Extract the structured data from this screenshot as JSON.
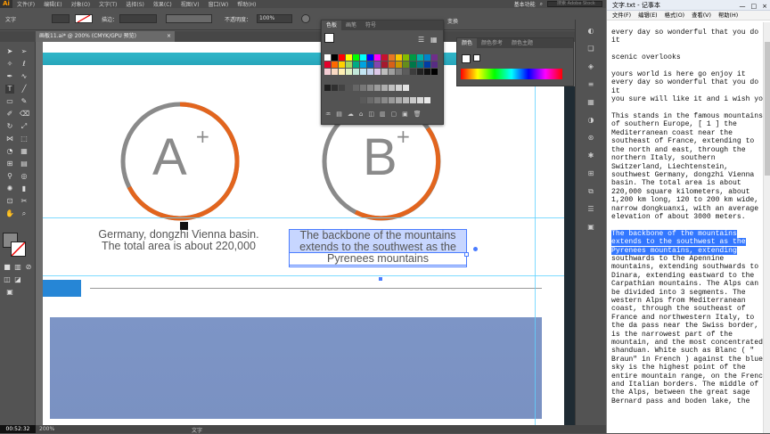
{
  "ai": {
    "logo": "Ai",
    "menus": [
      "文件(F)",
      "编辑(E)",
      "对象(O)",
      "文字(T)",
      "选择(S)",
      "效果(C)",
      "视图(V)",
      "窗口(W)",
      "帮助(H)"
    ],
    "workspace": "基本功能",
    "search_placeholder": "搜索 Adobe Stock",
    "control": {
      "mode_label": "文字",
      "stroke_label": "描边：",
      "opacity_label": "不透明度：",
      "opacity_value": "100%",
      "transform_label": "变换"
    },
    "doc_tab": "画板11.ai* @ 200% (CMYK/GPU 预览)",
    "doc_close": "×",
    "artboard": {
      "circle_a_letter": "A",
      "circle_a_plus": "+",
      "circle_b_letter": "B",
      "circle_b_plus": "+",
      "caption_a_line1": "Germany, dongzhi Vienna basin.",
      "caption_a_line2": "The total area is about 220,000",
      "caption_b_line1": "The backbone of the mountains",
      "caption_b_line2": "extends to the southwest as the",
      "caption_b_line3": "Pyrenees mountains"
    },
    "swatches_panel": {
      "tabs": [
        "色板",
        "画笔",
        "符号"
      ]
    },
    "color_panel": {
      "tabs": [
        "颜色",
        "颜色参考",
        "颜色主题"
      ]
    },
    "status": {
      "timer": "00:52:32",
      "zoom": "200%",
      "tool": "文字"
    },
    "colors": {
      "teal": "#2fb6c9",
      "orange": "#e2651e",
      "gray_ring": "#8a8a8a",
      "blue_block": "#7d95c6",
      "selection": "#3377ff"
    }
  },
  "notepad": {
    "title": "文字.txt - 记事本",
    "window_buttons": [
      "—",
      "□",
      "×"
    ],
    "menus": [
      "文件(F)",
      "编辑(E)",
      "格式(O)",
      "查看(V)",
      "帮助(H)"
    ],
    "text_before": "every day so wonderful that you do\nit\n\nscenic overlooks\n\nyours world is here go enjoy it\nevery day so wonderful that you do\nit\nyou sure will like it and i wish you\n\nThis stands in the famous mountains\nof southern Europe, [ 1 ] the\nMediterranean coast near the\nsoutheast of France, extending to\nthe north and east, through the\nnorthern Italy, southern\nSwitzerland, Liechtenstein,\nsouthwest Germany, dongzhi Vienna\nbasin. The total area is about\n220,000 square kilometers, about\n1,200 km long, 120 to 200 km wide,\nnarrow dongkuanxi, with an average\nelevation of about 3000 meters.\n\n",
    "text_selected": "The backbone of the mountains\nextends to the southwest as the\nPyrenees mountains, extending",
    "text_after": "\nsouthwards to the Apennine\nmountains, extending southwards to\nDinara, extending eastward to the\nCarpathian mountains. The Alps can\nbe divided into 3 segments. The\nwestern Alps from Mediterranean\ncoast, through the southeast of\nFrance and northwestern Italy, to\nthe da pass near the Swiss border,\nis the narrowest part of the\nmountain, and the most concentrated\nshanduan. White such as Blanc ( \"\nBraun\" in French ) against the blue\nsky is the highest point of the\nentire mountain range, on the French\nand Italian borders. The middle of\nthe Alps, between the great sage\nBernard pass and boden lake, the"
  }
}
